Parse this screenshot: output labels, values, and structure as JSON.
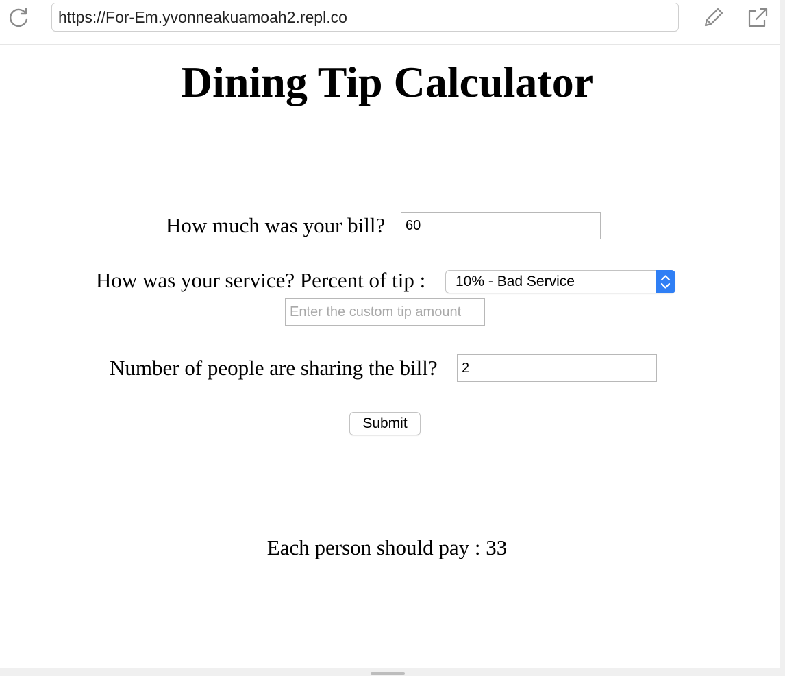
{
  "browser": {
    "url": "https://For-Em.yvonneakuamoah2.repl.co",
    "icons": [
      "reload-icon",
      "pencil-icon",
      "external-link-icon"
    ]
  },
  "page": {
    "title": "Dining Tip Calculator",
    "bill": {
      "label": "How much was your bill?",
      "value": "60"
    },
    "service": {
      "label": "How was your service? Percent of tip :",
      "selected": "10% - Bad Service"
    },
    "custom_tip": {
      "placeholder": "Enter the custom tip amount"
    },
    "people": {
      "label": "Number of people are sharing the bill?",
      "value": "2"
    },
    "submit_label": "Submit",
    "result": "Each person should pay : 33"
  },
  "colors": {
    "select_accent": "#2f7ff5"
  }
}
